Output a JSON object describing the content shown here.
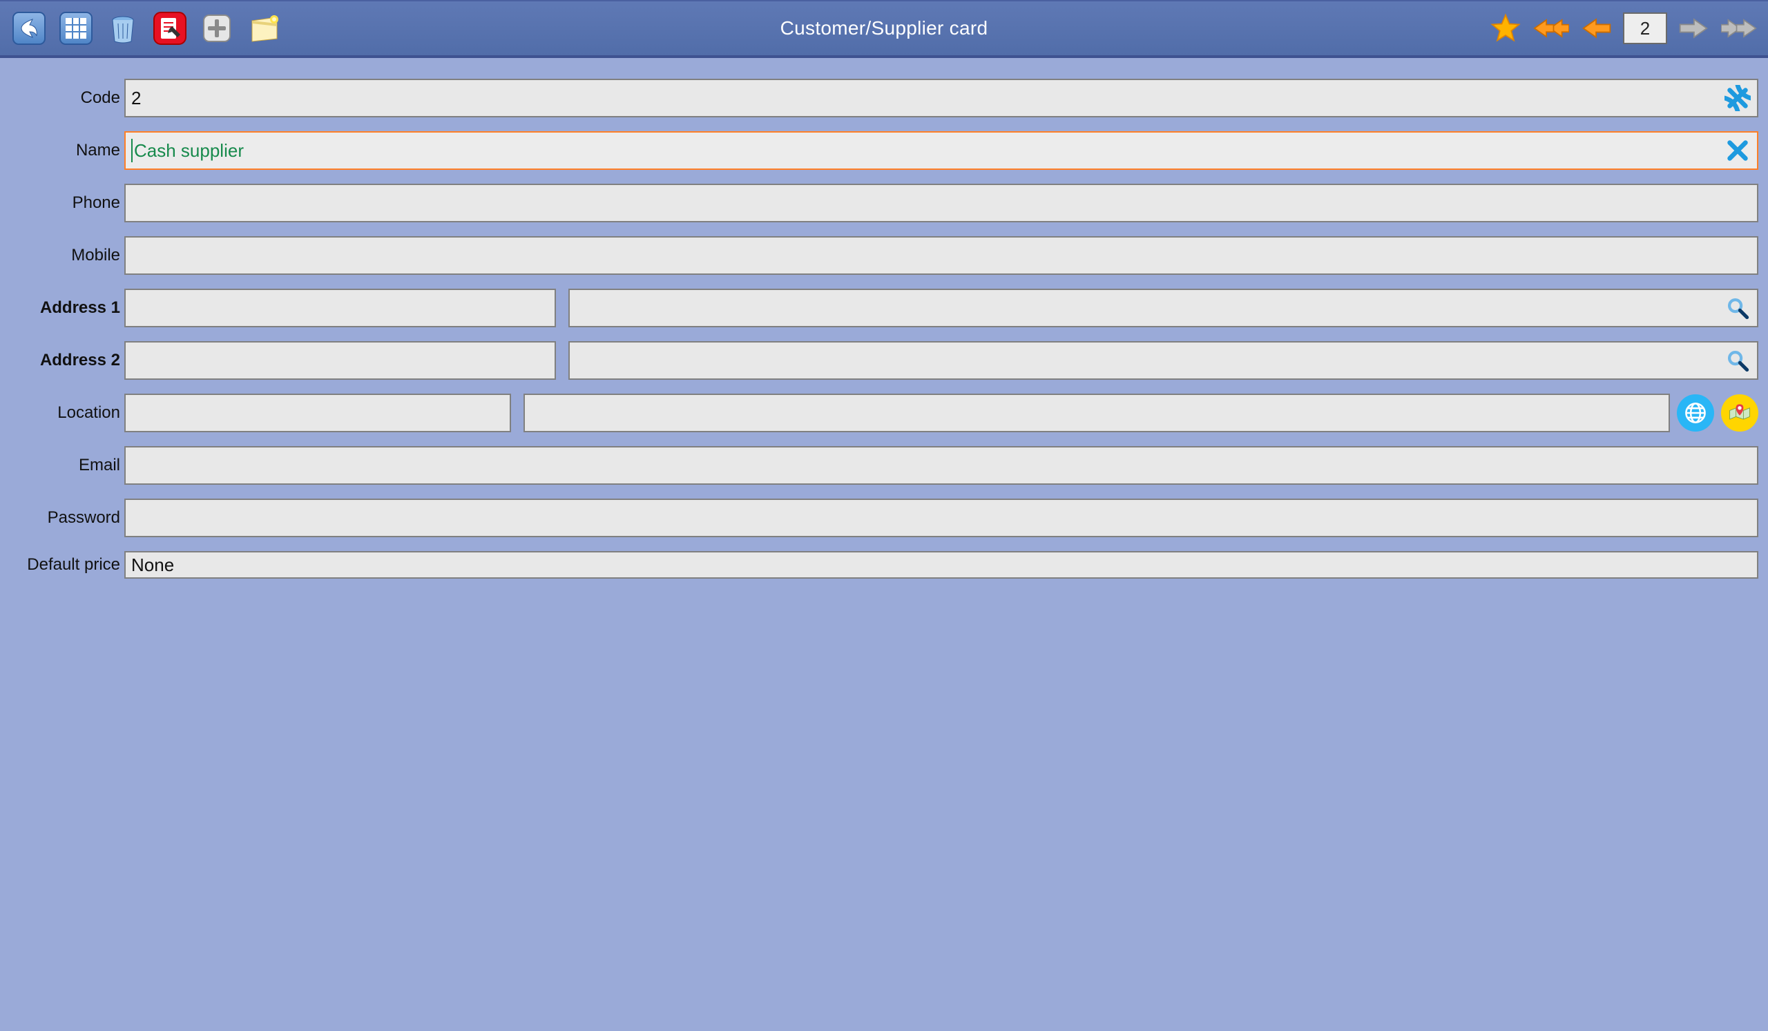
{
  "toolbar": {
    "title": "Customer/Supplier card",
    "record_number": "2"
  },
  "form": {
    "code": {
      "label": "Code",
      "value": "2"
    },
    "name": {
      "label": "Name",
      "value": "Cash supplier"
    },
    "phone": {
      "label": "Phone",
      "value": ""
    },
    "mobile": {
      "label": "Mobile",
      "value": ""
    },
    "address1": {
      "label": "Address 1",
      "a": "",
      "b": ""
    },
    "address2": {
      "label": "Address 2",
      "a": "",
      "b": ""
    },
    "location": {
      "label": "Location",
      "a": "",
      "b": ""
    },
    "email": {
      "label": "Email",
      "value": ""
    },
    "password": {
      "label": "Password",
      "value": ""
    },
    "default_price": {
      "label": "Default price",
      "value": "None"
    }
  }
}
